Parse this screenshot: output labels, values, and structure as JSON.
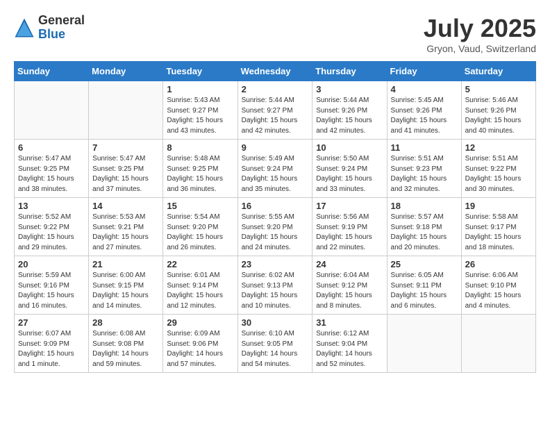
{
  "header": {
    "logo_general": "General",
    "logo_blue": "Blue",
    "month_year": "July 2025",
    "location": "Gryon, Vaud, Switzerland"
  },
  "weekdays": [
    "Sunday",
    "Monday",
    "Tuesday",
    "Wednesday",
    "Thursday",
    "Friday",
    "Saturday"
  ],
  "weeks": [
    [
      {
        "day": "",
        "info": ""
      },
      {
        "day": "",
        "info": ""
      },
      {
        "day": "1",
        "info": "Sunrise: 5:43 AM\nSunset: 9:27 PM\nDaylight: 15 hours and 43 minutes."
      },
      {
        "day": "2",
        "info": "Sunrise: 5:44 AM\nSunset: 9:27 PM\nDaylight: 15 hours and 42 minutes."
      },
      {
        "day": "3",
        "info": "Sunrise: 5:44 AM\nSunset: 9:26 PM\nDaylight: 15 hours and 42 minutes."
      },
      {
        "day": "4",
        "info": "Sunrise: 5:45 AM\nSunset: 9:26 PM\nDaylight: 15 hours and 41 minutes."
      },
      {
        "day": "5",
        "info": "Sunrise: 5:46 AM\nSunset: 9:26 PM\nDaylight: 15 hours and 40 minutes."
      }
    ],
    [
      {
        "day": "6",
        "info": "Sunrise: 5:47 AM\nSunset: 9:25 PM\nDaylight: 15 hours and 38 minutes."
      },
      {
        "day": "7",
        "info": "Sunrise: 5:47 AM\nSunset: 9:25 PM\nDaylight: 15 hours and 37 minutes."
      },
      {
        "day": "8",
        "info": "Sunrise: 5:48 AM\nSunset: 9:25 PM\nDaylight: 15 hours and 36 minutes."
      },
      {
        "day": "9",
        "info": "Sunrise: 5:49 AM\nSunset: 9:24 PM\nDaylight: 15 hours and 35 minutes."
      },
      {
        "day": "10",
        "info": "Sunrise: 5:50 AM\nSunset: 9:24 PM\nDaylight: 15 hours and 33 minutes."
      },
      {
        "day": "11",
        "info": "Sunrise: 5:51 AM\nSunset: 9:23 PM\nDaylight: 15 hours and 32 minutes."
      },
      {
        "day": "12",
        "info": "Sunrise: 5:51 AM\nSunset: 9:22 PM\nDaylight: 15 hours and 30 minutes."
      }
    ],
    [
      {
        "day": "13",
        "info": "Sunrise: 5:52 AM\nSunset: 9:22 PM\nDaylight: 15 hours and 29 minutes."
      },
      {
        "day": "14",
        "info": "Sunrise: 5:53 AM\nSunset: 9:21 PM\nDaylight: 15 hours and 27 minutes."
      },
      {
        "day": "15",
        "info": "Sunrise: 5:54 AM\nSunset: 9:20 PM\nDaylight: 15 hours and 26 minutes."
      },
      {
        "day": "16",
        "info": "Sunrise: 5:55 AM\nSunset: 9:20 PM\nDaylight: 15 hours and 24 minutes."
      },
      {
        "day": "17",
        "info": "Sunrise: 5:56 AM\nSunset: 9:19 PM\nDaylight: 15 hours and 22 minutes."
      },
      {
        "day": "18",
        "info": "Sunrise: 5:57 AM\nSunset: 9:18 PM\nDaylight: 15 hours and 20 minutes."
      },
      {
        "day": "19",
        "info": "Sunrise: 5:58 AM\nSunset: 9:17 PM\nDaylight: 15 hours and 18 minutes."
      }
    ],
    [
      {
        "day": "20",
        "info": "Sunrise: 5:59 AM\nSunset: 9:16 PM\nDaylight: 15 hours and 16 minutes."
      },
      {
        "day": "21",
        "info": "Sunrise: 6:00 AM\nSunset: 9:15 PM\nDaylight: 15 hours and 14 minutes."
      },
      {
        "day": "22",
        "info": "Sunrise: 6:01 AM\nSunset: 9:14 PM\nDaylight: 15 hours and 12 minutes."
      },
      {
        "day": "23",
        "info": "Sunrise: 6:02 AM\nSunset: 9:13 PM\nDaylight: 15 hours and 10 minutes."
      },
      {
        "day": "24",
        "info": "Sunrise: 6:04 AM\nSunset: 9:12 PM\nDaylight: 15 hours and 8 minutes."
      },
      {
        "day": "25",
        "info": "Sunrise: 6:05 AM\nSunset: 9:11 PM\nDaylight: 15 hours and 6 minutes."
      },
      {
        "day": "26",
        "info": "Sunrise: 6:06 AM\nSunset: 9:10 PM\nDaylight: 15 hours and 4 minutes."
      }
    ],
    [
      {
        "day": "27",
        "info": "Sunrise: 6:07 AM\nSunset: 9:09 PM\nDaylight: 15 hours and 1 minute."
      },
      {
        "day": "28",
        "info": "Sunrise: 6:08 AM\nSunset: 9:08 PM\nDaylight: 14 hours and 59 minutes."
      },
      {
        "day": "29",
        "info": "Sunrise: 6:09 AM\nSunset: 9:06 PM\nDaylight: 14 hours and 57 minutes."
      },
      {
        "day": "30",
        "info": "Sunrise: 6:10 AM\nSunset: 9:05 PM\nDaylight: 14 hours and 54 minutes."
      },
      {
        "day": "31",
        "info": "Sunrise: 6:12 AM\nSunset: 9:04 PM\nDaylight: 14 hours and 52 minutes."
      },
      {
        "day": "",
        "info": ""
      },
      {
        "day": "",
        "info": ""
      }
    ]
  ]
}
